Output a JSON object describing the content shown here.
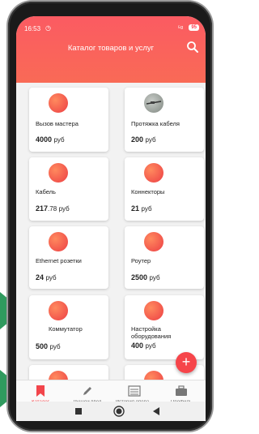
{
  "status_bar": {
    "time": "16:53",
    "alarm_icon": "alarm-icon",
    "signal_text": "⁵ᵍ",
    "battery": "95"
  },
  "app_bar": {
    "title": "Каталог товаров и услуг",
    "search_icon": "search-icon"
  },
  "colors": {
    "accent": "#f6454a",
    "app_bar": "#fb5b62",
    "card_icon": "#f2554c"
  },
  "currency": "руб",
  "catalog_items": [
    {
      "name": "Вызов мастера",
      "price": "4000",
      "price_fraction": "",
      "icon": "circle"
    },
    {
      "name": "Протяжка кабеля",
      "price": "200",
      "price_fraction": "",
      "icon": "cable-photo"
    },
    {
      "name": "Кабель",
      "price": "217",
      "price_fraction": ".78",
      "icon": "circle"
    },
    {
      "name": "Коннекторы",
      "price": "21",
      "price_fraction": "",
      "icon": "circle"
    },
    {
      "name": "Ethernet розетки",
      "price": "24",
      "price_fraction": "",
      "icon": "circle"
    },
    {
      "name": "Роутер",
      "price": "2500",
      "price_fraction": "",
      "icon": "circle"
    },
    {
      "name": "Коммутатор",
      "price": "500",
      "price_fraction": "",
      "icon": "circle"
    },
    {
      "name": "Настройка оборудования",
      "price": "400",
      "price_fraction": "",
      "icon": "circle"
    }
  ],
  "fab": {
    "label": "+"
  },
  "bottom_nav": [
    {
      "label": "Каталог",
      "icon": "bookmark-icon",
      "active": true
    },
    {
      "label": "Ручной ввод",
      "icon": "pencil-icon",
      "active": false
    },
    {
      "label": "История опера...",
      "icon": "list-icon",
      "active": false
    },
    {
      "label": "Профиль",
      "icon": "briefcase-icon",
      "active": false
    }
  ],
  "system_nav": {
    "square": "square-icon",
    "home": "home-icon",
    "back": "back-icon"
  }
}
